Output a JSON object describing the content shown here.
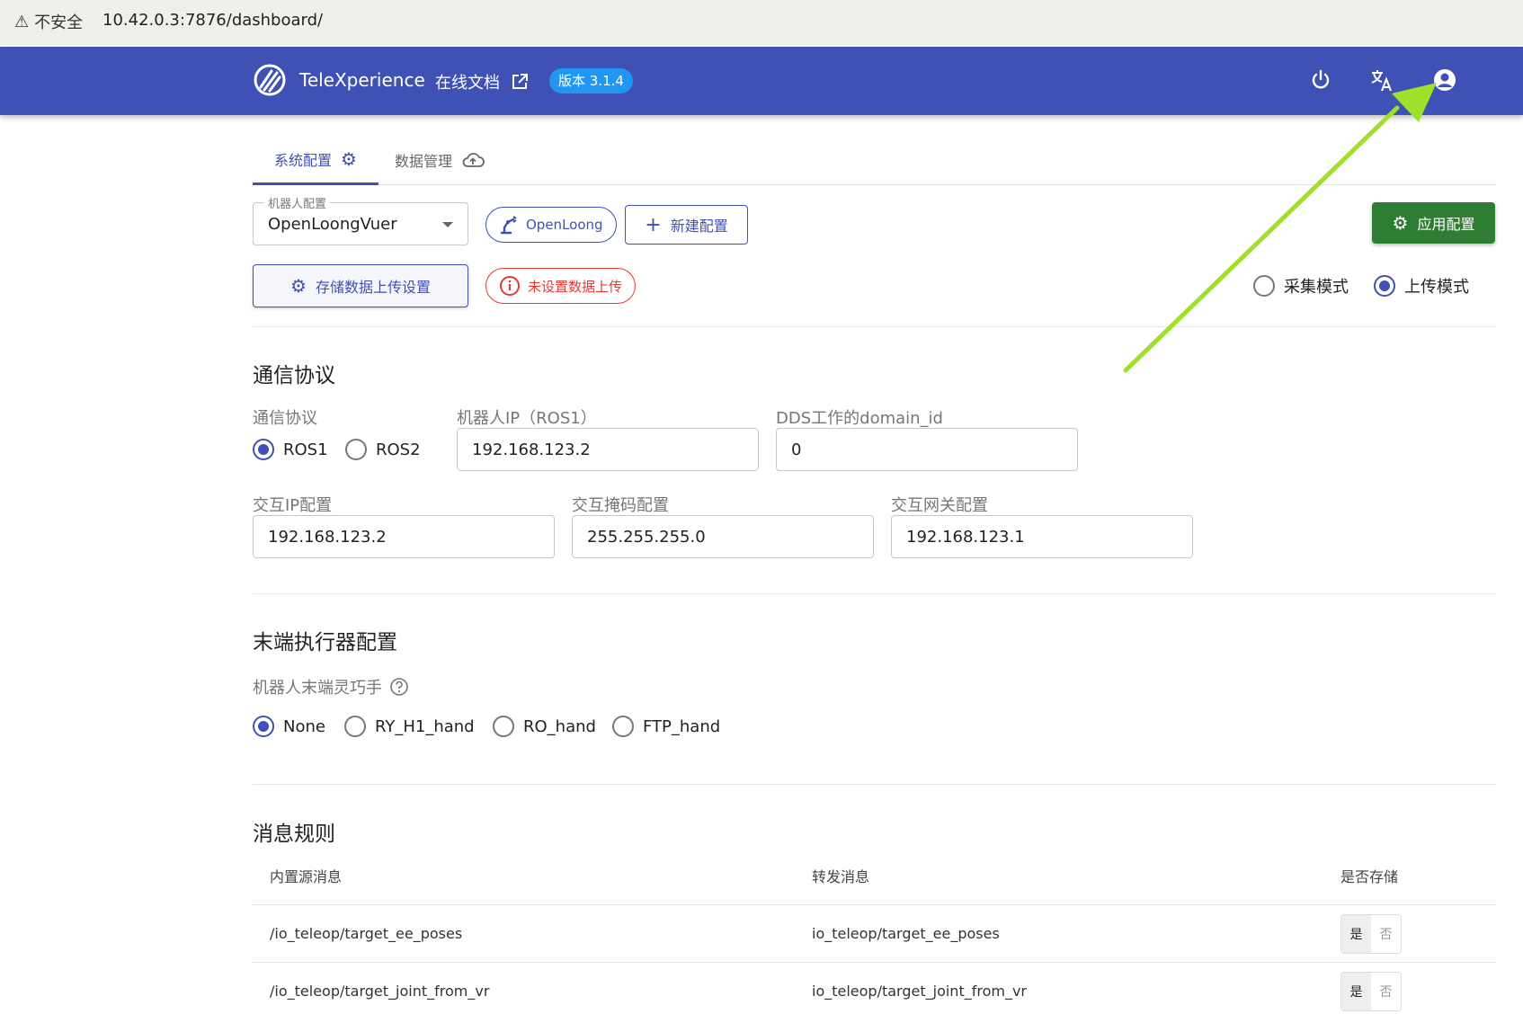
{
  "browser": {
    "security_label": "不安全",
    "url": "10.42.0.3:7876/dashboard/"
  },
  "header": {
    "brand": "TeleXperience",
    "docs_label": "在线文档",
    "version": "版本 3.1.4",
    "icons": [
      "power-icon",
      "translate-icon",
      "account-icon"
    ],
    "color": "#3f51b5"
  },
  "tabs": [
    {
      "label": "系统配置"
    },
    {
      "label": "数据管理"
    }
  ],
  "robot_config": {
    "select_label": "机器人配置",
    "select_value": "OpenLoongVuer",
    "robot_badge": "OpenLoong",
    "new_config": "新建配置",
    "storage_upload": "存储数据上传设置",
    "upload_warning": "未设置数据上传",
    "apply": "应用配置",
    "modes": [
      {
        "label": "采集模式",
        "selected": false
      },
      {
        "label": "上传模式",
        "selected": true
      }
    ]
  },
  "comm": {
    "title": "通信协议",
    "protocol_label": "通信协议",
    "protocols": [
      {
        "label": "ROS1",
        "selected": true
      },
      {
        "label": "ROS2",
        "selected": false
      }
    ],
    "robot_ip_label": "机器人IP（ROS1）",
    "robot_ip": "192.168.123.2",
    "domain_label": "DDS工作的domain_id",
    "domain_id": "0",
    "ip_label": "交互IP配置",
    "ip": "192.168.123.2",
    "mask_label": "交互掩码配置",
    "mask": "255.255.255.0",
    "gateway_label": "交互网关配置",
    "gateway": "192.168.123.1"
  },
  "effector": {
    "title": "末端执行器配置",
    "hand_label": "机器人末端灵巧手",
    "options": [
      {
        "label": "None",
        "selected": true
      },
      {
        "label": "RY_H1_hand",
        "selected": false
      },
      {
        "label": "RO_hand",
        "selected": false
      },
      {
        "label": "FTP_hand",
        "selected": false
      }
    ]
  },
  "rules": {
    "title": "消息规则",
    "headers": [
      "内置源消息",
      "转发消息",
      "是否存储"
    ],
    "rows": [
      {
        "source": "/io_teleop/target_ee_poses",
        "forward": "io_teleop/target_ee_poses",
        "yes": "是",
        "no": "否"
      },
      {
        "source": "/io_teleop/target_joint_from_vr",
        "forward": "io_teleop/target_joint_from_vr",
        "yes": "是",
        "no": "否"
      }
    ]
  },
  "annotation_color": "#9ee02a"
}
